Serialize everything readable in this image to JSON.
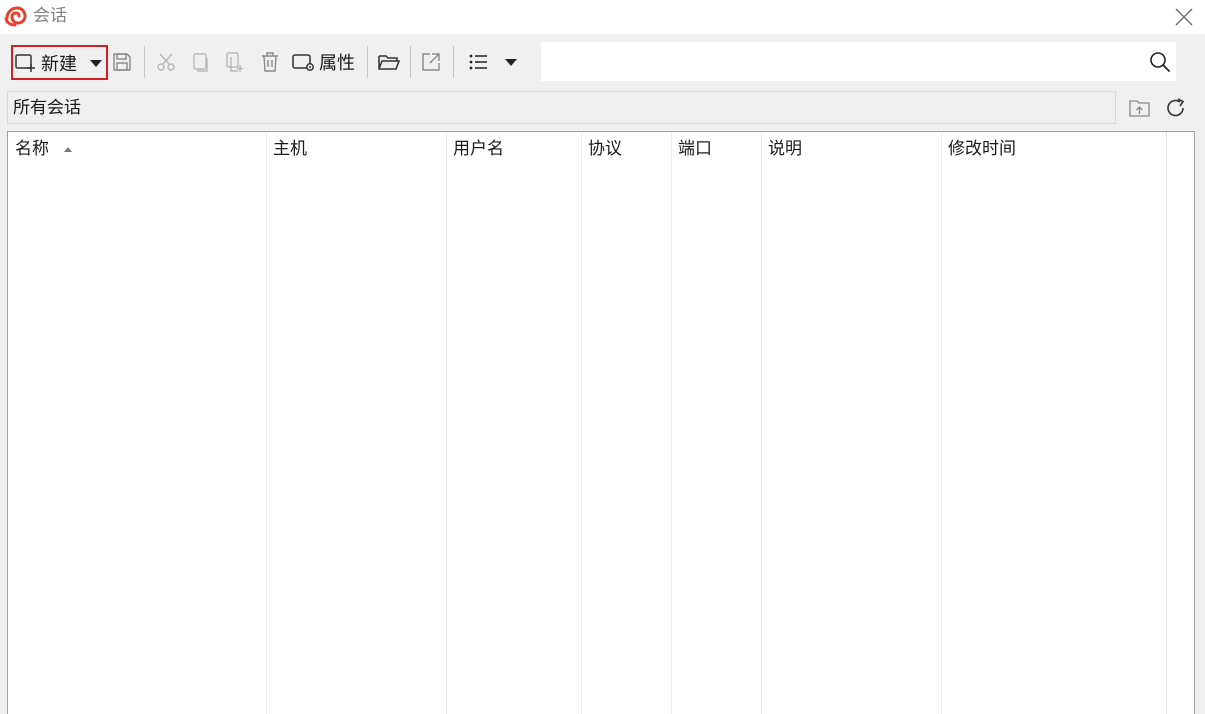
{
  "window": {
    "title": "会话"
  },
  "toolbar": {
    "new_label": "新建",
    "properties_label": "属性",
    "search": {
      "value": "",
      "placeholder": ""
    }
  },
  "pathbar": {
    "path": "所有会话"
  },
  "table": {
    "columns": [
      {
        "label": "名称",
        "sorted": "ascending"
      },
      {
        "label": "主机"
      },
      {
        "label": "用户名"
      },
      {
        "label": "协议"
      },
      {
        "label": "端口"
      },
      {
        "label": "说明"
      },
      {
        "label": "修改时间"
      }
    ],
    "rows": []
  },
  "colors": {
    "accent_red": "#d1202a",
    "logo_red": "#e8402e",
    "disabled_icon": "#b8b8b8"
  }
}
